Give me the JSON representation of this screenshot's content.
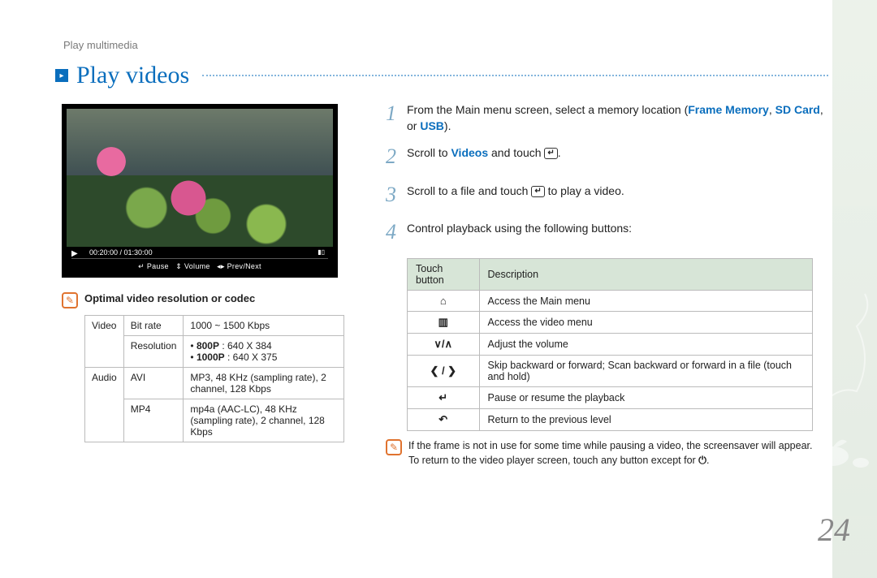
{
  "breadcrumb": "Play multimedia",
  "heading": "Play videos",
  "video_thumb": {
    "time": "00:20:00 / 01:30:00",
    "ctrl_pause": "Pause",
    "ctrl_volume": "Volume",
    "ctrl_prevnext": "Prev/Next"
  },
  "spec_note_title": "Optimal video resolution or codec",
  "spec": {
    "video_label": "Video",
    "bitrate_label": "Bit rate",
    "bitrate_val": "1000 ~ 1500 Kbps",
    "res_label": "Resolution",
    "res_800": "800P",
    "res_800_val": " : 640 X 384",
    "res_1000": "1000P",
    "res_1000_val": " : 640 X 375",
    "audio_label": "Audio",
    "avi_label": "AVI",
    "avi_val": "MP3, 48 KHz (sampling rate), 2 channel, 128 Kbps",
    "mp4_label": "MP4",
    "mp4_val": "mp4a (AAC-LC), 48 KHz (sampling rate), 2 channel, 128 Kbps"
  },
  "steps": {
    "s1a": "From the Main menu screen, select a memory location (",
    "s1_fm": "Frame Memory",
    "s1_sep1": ", ",
    "s1_sd": "SD Card",
    "s1_sep2": ", or ",
    "s1_usb": "USB",
    "s1b": ").",
    "s2a": "Scroll to ",
    "s2_link": "Videos",
    "s2b": " and touch ",
    "s2c": ".",
    "s3a": "Scroll to a file and touch ",
    "s3b": " to play a video.",
    "s4": "Control playback using the following buttons:"
  },
  "btn_table": {
    "h1": "Touch button",
    "h2": "Description",
    "rows": [
      {
        "icon": "⌂",
        "desc": "Access the Main menu"
      },
      {
        "icon": "▥",
        "desc": "Access the video menu"
      },
      {
        "icon": "∨/∧",
        "desc": "Adjust the volume"
      },
      {
        "icon": "❮ / ❯",
        "desc": "Skip backward or forward; Scan backward or forward in a file (touch and hold)"
      },
      {
        "icon": "↵",
        "desc": "Pause or resume the playback"
      },
      {
        "icon": "↶",
        "desc": "Return to the previous level"
      }
    ]
  },
  "footnote": {
    "a": "If the frame is not in use for some time while pausing a video, the screensaver will appear. To return to the video player screen, touch any button except for ",
    "b": "."
  },
  "page_number": "24"
}
